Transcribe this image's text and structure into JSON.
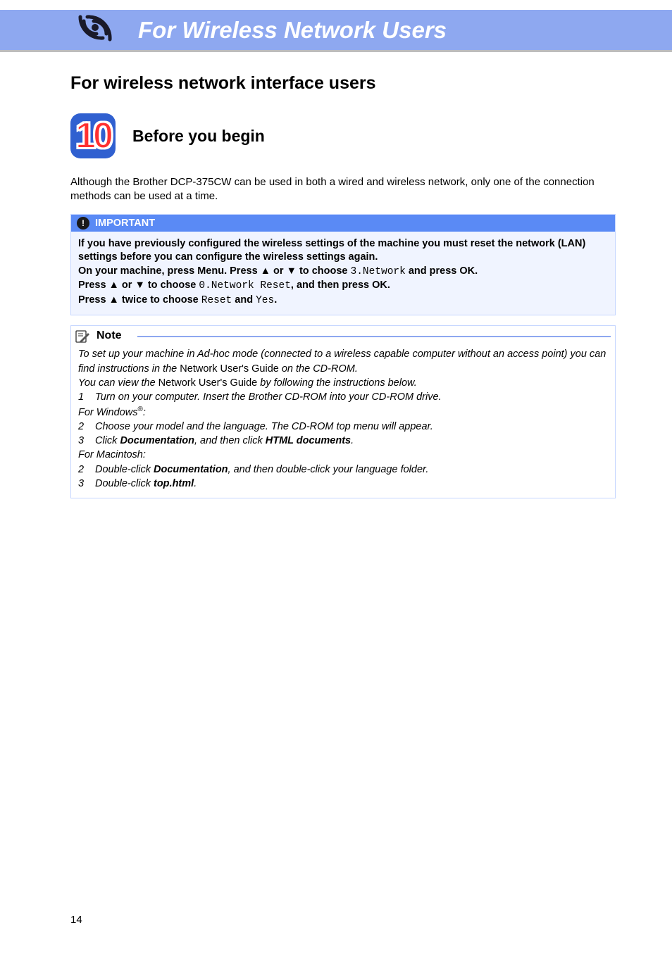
{
  "header": {
    "title": "For Wireless Network Users"
  },
  "section": {
    "title": "For wireless network interface users"
  },
  "step": {
    "number": "10",
    "title": "Before you begin"
  },
  "intro": "Although the Brother DCP-375CW can be used in both a wired and wireless network, only one of the connection methods can be used at a time.",
  "important": {
    "label": "IMPORTANT",
    "line1a": "If you have previously configured the wireless settings of the machine you must reset the network (LAN) settings before you can configure the wireless settings again.",
    "line2a": "On your machine, press Menu. Press ",
    "up1": "a",
    "line2b": " or ",
    "down1": "b",
    "line2c": " to choose ",
    "code1": "3.Network",
    "line2d": " and press OK.",
    "line3a": "Press ",
    "up2": "a",
    "line3b": " or ",
    "down2": "b",
    "line3c": " to choose ",
    "code2": "0.Network Reset",
    "line3d": ", and then press OK.",
    "line4a": "Press ",
    "up3": "a",
    "line4b": " twice to choose ",
    "code3": "Reset",
    "line4c": " and ",
    "code4": "Yes",
    "line4d": "."
  },
  "note": {
    "label": "Note",
    "p1a": "To set up your machine in Ad-hoc mode (connected to a wireless capable computer without an access point) you can find instructions in the ",
    "p1b": "Network User's Guide",
    "p1c": " on the CD-ROM.",
    "p2a": "You can view the ",
    "p2b": "Network User's Guide",
    "p2c": " by following the instructions below.",
    "w1n": "1",
    "w1t": "Turn on your computer. Insert the Brother CD-ROM into your CD-ROM drive.",
    "win_label_a": "For Windows",
    "win_label_b": ":",
    "w2n": "2",
    "w2t_a": "Choose your model and the language. The CD-ROM top menu will appear.",
    "w3n": "3",
    "w3t_a": "Click ",
    "w3t_b": "Documentation",
    "w3t_c": ", and then click ",
    "w3t_d": "HTML documents",
    "w3t_e": ".",
    "mac_label": "For Macintosh:",
    "m2n": "2",
    "m2t_a": "Double-click ",
    "m2t_b": "Documentation",
    "m2t_c": ", and then double-click your language folder.",
    "m3n": "3",
    "m3t_a": "Double-click ",
    "m3t_b": "top.html",
    "m3t_c": "."
  },
  "page_number": "14"
}
